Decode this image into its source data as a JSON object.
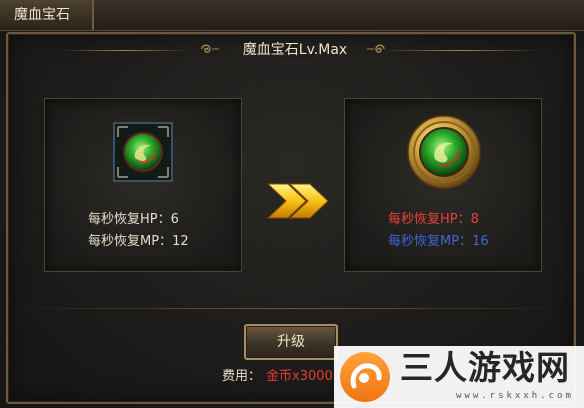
{
  "window": {
    "title": "魔血宝石"
  },
  "panel": {
    "title": "魔血宝石Lv.Max"
  },
  "current": {
    "hp_label": "每秒恢复HP：",
    "hp_value": "6",
    "mp_label": "每秒恢复MP：",
    "mp_value": "12",
    "icon": "green-gem-square-icon"
  },
  "next": {
    "hp_label": "每秒恢复HP：",
    "hp_value": "8",
    "mp_label": "每秒恢复MP：",
    "mp_value": "16",
    "icon": "green-gem-gold-medallion-icon",
    "hp_color": "#e8413a",
    "mp_color": "#3f66d6"
  },
  "upgrade": {
    "button_label": "升级",
    "fee_label": "费用：",
    "fee_value": "金币x3000"
  },
  "watermark": {
    "title": "三人游戏网",
    "url": "www.rskxxh.com"
  },
  "colors": {
    "gold_text": "#efe4cc",
    "fee_red": "#e53b2e",
    "arrow_yellow": "#f6c214"
  }
}
